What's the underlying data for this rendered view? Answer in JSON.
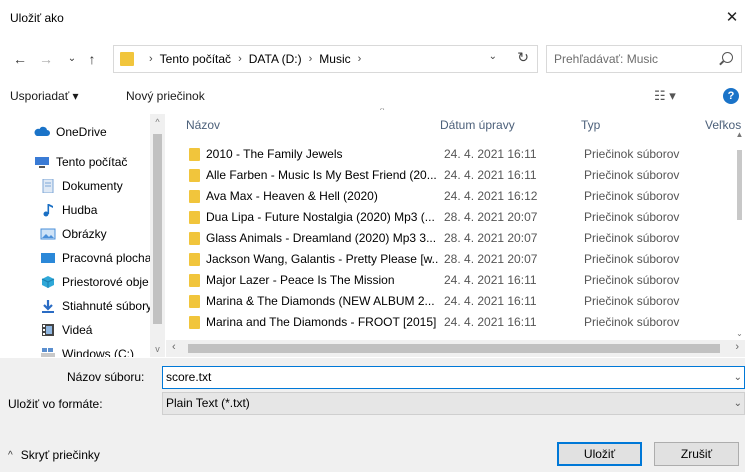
{
  "window": {
    "title": "Uložiť ako",
    "close_glyph": "✕"
  },
  "nav": {
    "back": "←",
    "forward": "→",
    "history": "⌄",
    "up": "↑",
    "breadcrumbs": [
      "Tento počítač",
      "DATA (D:)",
      "Music"
    ],
    "refresh": "↻",
    "search_placeholder": "Prehľadávať: Music"
  },
  "toolbar": {
    "organize": "Usporiadať ▾",
    "new_folder": "Nový priečinok",
    "view_glyph": "☷ ▾",
    "help": "?"
  },
  "sidebar": {
    "items": [
      {
        "label": "OneDrive",
        "icon": "cloud-icon",
        "color": "#1a73c8"
      },
      {
        "label": "Tento počítač",
        "icon": "computer-icon",
        "color": "#3a7bd5"
      },
      {
        "label": "Dokumenty",
        "icon": "documents-icon",
        "color": "#7ea6d6"
      },
      {
        "label": "Hudba",
        "icon": "music-icon",
        "color": "#1a6fc4"
      },
      {
        "label": "Obrázky",
        "icon": "pictures-icon",
        "color": "#4a8fd9"
      },
      {
        "label": "Pracovná plocha",
        "icon": "desktop-icon",
        "color": "#2b88d8"
      },
      {
        "label": "Priestorové obje",
        "icon": "3d-objects-icon",
        "color": "#2fa8d8"
      },
      {
        "label": "Stiahnuté súbory",
        "icon": "downloads-icon",
        "color": "#2b6cc4"
      },
      {
        "label": "Videá",
        "icon": "videos-icon",
        "color": "#444444"
      },
      {
        "label": "Windows (C:)",
        "icon": "drive-icon",
        "color": "#5b8fcf"
      }
    ]
  },
  "columns": {
    "name": "Názov",
    "date": "Dátum úpravy",
    "type": "Typ",
    "size": "Veľkos"
  },
  "files": [
    {
      "name": "2010 - The Family Jewels",
      "date": "24. 4. 2021 16:11",
      "type": "Priečinok súborov"
    },
    {
      "name": "Alle Farben - Music Is My Best Friend (20...",
      "date": "24. 4. 2021 16:11",
      "type": "Priečinok súborov"
    },
    {
      "name": "Ava Max - Heaven & Hell (2020)",
      "date": "24. 4. 2021 16:12",
      "type": "Priečinok súborov"
    },
    {
      "name": "Dua Lipa - Future Nostalgia (2020) Mp3 (...",
      "date": "28. 4. 2021 20:07",
      "type": "Priečinok súborov"
    },
    {
      "name": "Glass Animals - Dreamland (2020) Mp3 3...",
      "date": "28. 4. 2021 20:07",
      "type": "Priečinok súborov"
    },
    {
      "name": "Jackson Wang, Galantis - Pretty Please [w...",
      "date": "28. 4. 2021 20:07",
      "type": "Priečinok súborov"
    },
    {
      "name": "Major Lazer - Peace Is The Mission",
      "date": "24. 4. 2021 16:11",
      "type": "Priečinok súborov"
    },
    {
      "name": "Marina & The Diamonds (NEW ALBUM 2...",
      "date": "24. 4. 2021 16:11",
      "type": "Priečinok súborov"
    },
    {
      "name": "Marina and The Diamonds - FROOT [2015]",
      "date": "24. 4. 2021 16:11",
      "type": "Priečinok súborov"
    }
  ],
  "form": {
    "filename_label": "Názov súboru:",
    "filename_value": "score.txt",
    "format_label": "Uložiť vo formáte:",
    "format_value": "Plain Text (*.txt)",
    "hide_folders": "Skryť priečinky",
    "save": "Uložiť",
    "cancel": "Zrušiť"
  },
  "colors": {
    "accent": "#0078d7",
    "folder": "#f1c53c",
    "header_text": "#4c607a",
    "bottom_panel": "#f0f0f0"
  }
}
